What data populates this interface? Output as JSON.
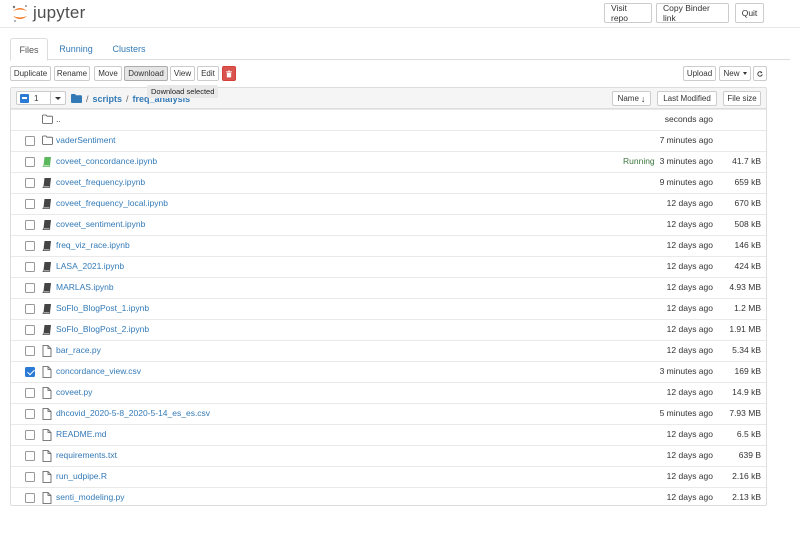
{
  "header": {
    "logo_text": "jupyter",
    "buttons": [
      "Visit repo",
      "Copy Binder link",
      "Quit"
    ]
  },
  "tabs": [
    "Files",
    "Running",
    "Clusters"
  ],
  "toolbar": {
    "left": [
      "Duplicate",
      "Rename",
      "Move",
      "Download",
      "View",
      "Edit"
    ],
    "upload": "Upload",
    "new": "New",
    "tooltip": "Download selected"
  },
  "list_header": {
    "selected_count": "1",
    "breadcrumb": [
      "scripts",
      "freq_analysis"
    ],
    "sort_name": "Name",
    "last_modified": "Last Modified",
    "file_size": "File size"
  },
  "rows": [
    {
      "name": "..",
      "type": "folder",
      "modified": "seconds ago",
      "size": "",
      "checked": false,
      "running": ""
    },
    {
      "name": "vaderSentiment",
      "type": "folder",
      "modified": "7 minutes ago",
      "size": "",
      "checked": false,
      "running": ""
    },
    {
      "name": "coveet_concordance.ipynb",
      "type": "notebook-running",
      "modified": "3 minutes ago",
      "size": "41.7 kB",
      "checked": false,
      "running": "Running"
    },
    {
      "name": "coveet_frequency.ipynb",
      "type": "notebook",
      "modified": "9 minutes ago",
      "size": "659 kB",
      "checked": false,
      "running": ""
    },
    {
      "name": "coveet_frequency_local.ipynb",
      "type": "notebook",
      "modified": "12 days ago",
      "size": "670 kB",
      "checked": false,
      "running": ""
    },
    {
      "name": "coveet_sentiment.ipynb",
      "type": "notebook",
      "modified": "12 days ago",
      "size": "508 kB",
      "checked": false,
      "running": ""
    },
    {
      "name": "freq_viz_race.ipynb",
      "type": "notebook",
      "modified": "12 days ago",
      "size": "146 kB",
      "checked": false,
      "running": ""
    },
    {
      "name": "LASA_2021.ipynb",
      "type": "notebook",
      "modified": "12 days ago",
      "size": "424 kB",
      "checked": false,
      "running": ""
    },
    {
      "name": "MARLAS.ipynb",
      "type": "notebook",
      "modified": "12 days ago",
      "size": "4.93 MB",
      "checked": false,
      "running": ""
    },
    {
      "name": "SoFlo_BlogPost_1.ipynb",
      "type": "notebook",
      "modified": "12 days ago",
      "size": "1.2 MB",
      "checked": false,
      "running": ""
    },
    {
      "name": "SoFlo_BlogPost_2.ipynb",
      "type": "notebook",
      "modified": "12 days ago",
      "size": "1.91 MB",
      "checked": false,
      "running": ""
    },
    {
      "name": "bar_race.py",
      "type": "file",
      "modified": "12 days ago",
      "size": "5.34 kB",
      "checked": false,
      "running": ""
    },
    {
      "name": "concordance_view.csv",
      "type": "file",
      "modified": "3 minutes ago",
      "size": "169 kB",
      "checked": true,
      "running": ""
    },
    {
      "name": "coveet.py",
      "type": "file",
      "modified": "12 days ago",
      "size": "14.9 kB",
      "checked": false,
      "running": ""
    },
    {
      "name": "dhcovid_2020-5-8_2020-5-14_es_es.csv",
      "type": "file",
      "modified": "5 minutes ago",
      "size": "7.93 MB",
      "checked": false,
      "running": ""
    },
    {
      "name": "README.md",
      "type": "file",
      "modified": "12 days ago",
      "size": "6.5 kB",
      "checked": false,
      "running": ""
    },
    {
      "name": "requirements.txt",
      "type": "file",
      "modified": "12 days ago",
      "size": "639 B",
      "checked": false,
      "running": ""
    },
    {
      "name": "run_udpipe.R",
      "type": "file",
      "modified": "12 days ago",
      "size": "2.16 kB",
      "checked": false,
      "running": ""
    },
    {
      "name": "senti_modeling.py",
      "type": "file",
      "modified": "12 days ago",
      "size": "2.13 kB",
      "checked": false,
      "running": ""
    }
  ],
  "colors": {
    "link": "#337ab7",
    "running": "#3c763d",
    "checkbox": "#2b7bd6",
    "danger": "#d9534f",
    "logo_orange": "#f37726"
  }
}
